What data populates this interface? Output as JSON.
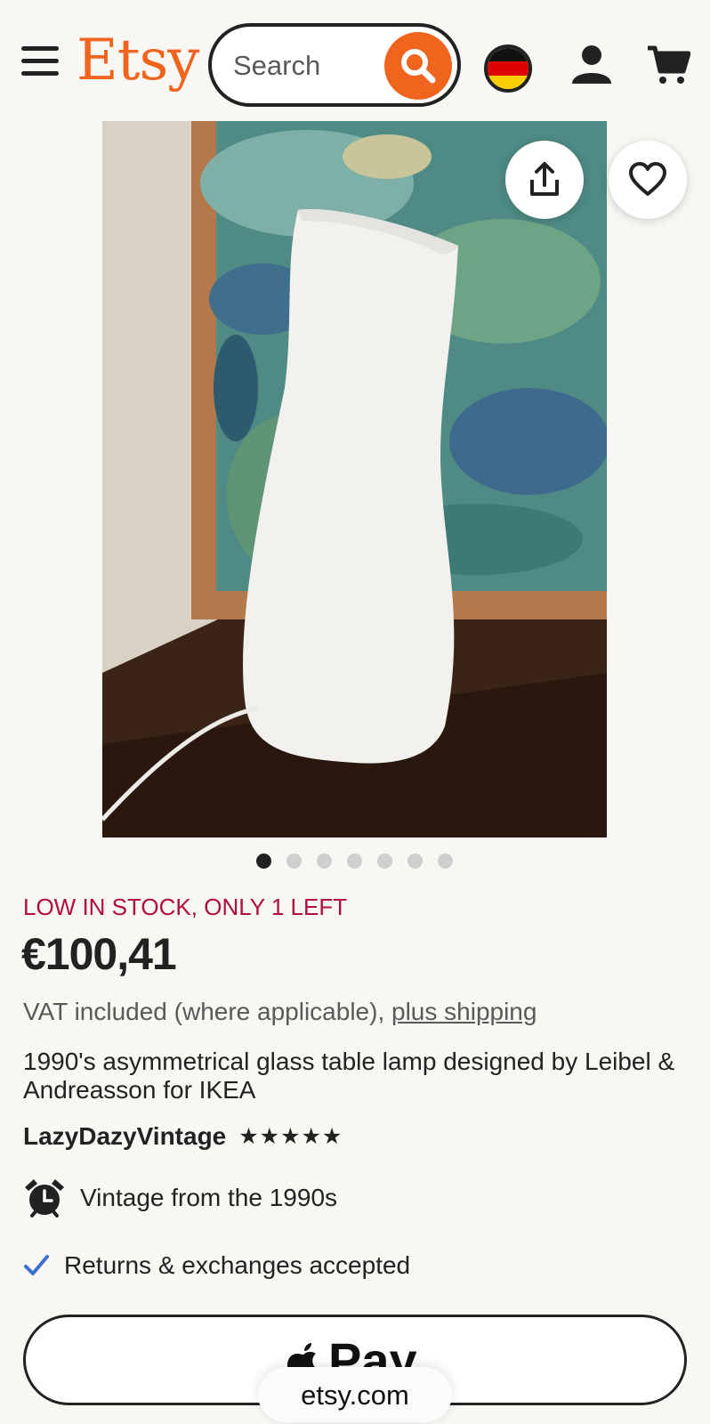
{
  "header": {
    "logo": "Etsy",
    "search_placeholder": "Search",
    "icons": [
      "menu-icon",
      "search-icon",
      "germany-flag-icon",
      "user-icon",
      "cart-icon"
    ]
  },
  "listing": {
    "image_count": 7,
    "active_image": 1,
    "stock_notice": "LOW IN STOCK, ONLY 1 LEFT",
    "price": "€100,41",
    "vat_text": "VAT included (where applicable), ",
    "shipping_link": "plus shipping",
    "title": "1990's asymmetrical glass table lamp designed by Leibel & Andreasson for IKEA",
    "seller": "LazyDazyVintage",
    "rating_stars": "★★★★★",
    "rating_value": 5,
    "feature_vintage": "Vintage from the 1990s",
    "feature_returns": "Returns & exchanges accepted"
  },
  "checkout": {
    "apple_pay_label": "Pay"
  },
  "browser": {
    "url": "etsy.com"
  },
  "colors": {
    "brand": "#f1641e",
    "stock_alert": "#b10e3b",
    "text": "#222222",
    "check": "#3b6fd1"
  }
}
